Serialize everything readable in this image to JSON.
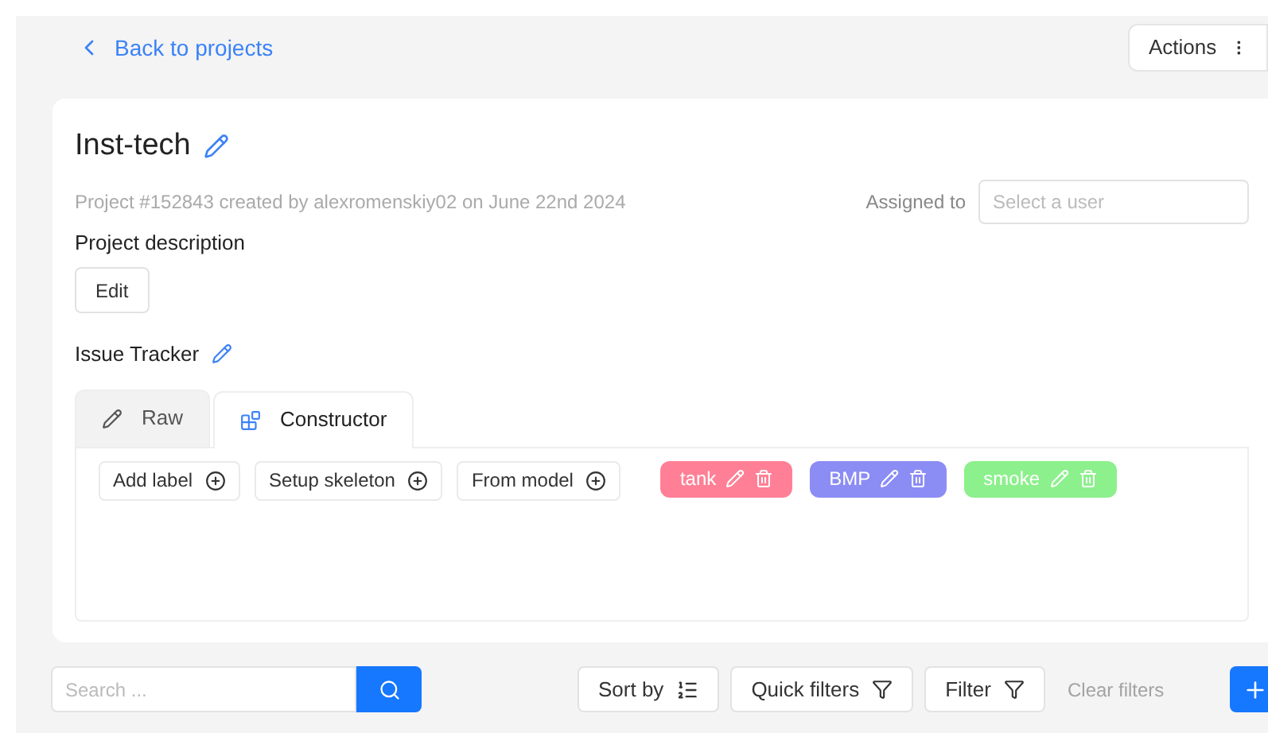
{
  "back_link": "Back to projects",
  "actions_button": "Actions",
  "project": {
    "title": "Inst-tech",
    "meta": "Project #152843 created by alexromenskiy02 on June 22nd 2024",
    "assigned_label": "Assigned to",
    "assignee": {
      "placeholder": "Select a user"
    },
    "description_label": "Project description",
    "edit_button": "Edit"
  },
  "issue_tracker": "Issue Tracker",
  "tabs": [
    {
      "label": "Raw",
      "kind": "raw",
      "selected": false
    },
    {
      "label": "Constructor",
      "kind": "constructor",
      "selected": true
    }
  ],
  "constructor_buttons": [
    "Add label",
    "Setup skeleton",
    "From model"
  ],
  "labels": [
    {
      "name": "tank",
      "color": "#ff8096"
    },
    {
      "name": "BMP",
      "color": "#8c8cf5"
    },
    {
      "name": "smoke",
      "color": "#8cf08c"
    }
  ],
  "toolbar": {
    "search": {
      "placeholder": "Search ..."
    },
    "sort_button": "Sort by",
    "quick_filters_button": "Quick filters",
    "filter_button": "Filter",
    "clear_filters": "Clear filters"
  }
}
